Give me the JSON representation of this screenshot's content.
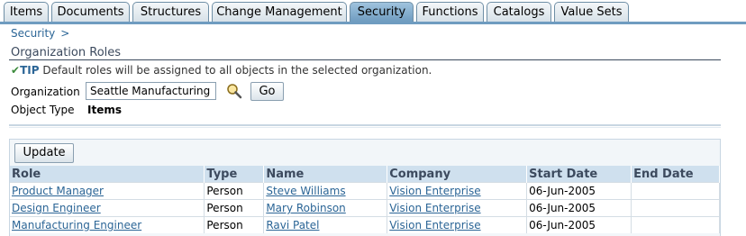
{
  "tabs": [
    {
      "label": "Items",
      "active": false
    },
    {
      "label": "Documents",
      "active": false
    },
    {
      "label": "Structures",
      "active": false
    },
    {
      "label": "Change Management",
      "active": false
    },
    {
      "label": "Security",
      "active": true
    },
    {
      "label": "Functions",
      "active": false
    },
    {
      "label": "Catalogs",
      "active": false
    },
    {
      "label": "Value Sets",
      "active": false
    }
  ],
  "breadcrumb": {
    "root": "Security",
    "separator": ">"
  },
  "section": {
    "title": "Organization Roles"
  },
  "tip": {
    "label": "TIP",
    "text": "Default roles will be assigned to all objects in the selected organization."
  },
  "form": {
    "organization_label": "Organization",
    "organization_value": "Seattle Manufacturing",
    "go_label": "Go",
    "object_type_label": "Object Type",
    "object_type_value": "Items"
  },
  "table": {
    "update_label": "Update",
    "columns": [
      "Role",
      "Type",
      "Name",
      "Company",
      "Start Date",
      "End Date"
    ],
    "rows": [
      {
        "role": "Product Manager",
        "type": "Person",
        "name": "Steve Williams",
        "company": "Vision Enterprise",
        "start": "06-Jun-2005",
        "end": ""
      },
      {
        "role": "Design Engineer",
        "type": "Person",
        "name": "Mary Robinson",
        "company": "Vision Enterprise",
        "start": "06-Jun-2005",
        "end": ""
      },
      {
        "role": "Manufacturing Engineer",
        "type": "Person",
        "name": "Ravi Patel",
        "company": "Vision Enterprise",
        "start": "06-Jun-2005",
        "end": ""
      }
    ]
  },
  "colors": {
    "accent": "#6f9cc0",
    "link": "#2b6596",
    "header_bg": "#cfe0ee"
  },
  "icons": {
    "search": "flashlight-search-icon",
    "tip": "checkmark-icon"
  }
}
